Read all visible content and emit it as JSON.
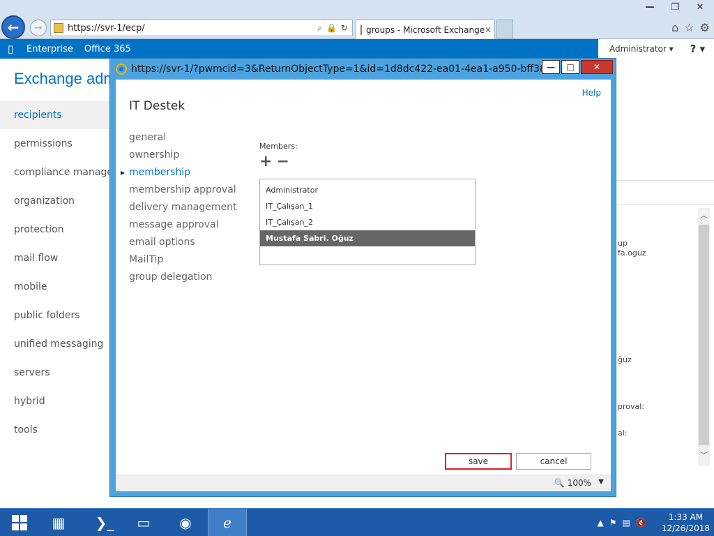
{
  "browser": {
    "address": "https://svr-1/ecp/",
    "tab_title": "groups - Microsoft Exchange",
    "tab_close": "✕",
    "window_controls": {
      "minimize": "—",
      "restore": "❐",
      "close": "✕"
    }
  },
  "topbar": {
    "logo": "▯",
    "links": [
      "Enterprise",
      "Office 365"
    ],
    "user": "Administrator ▾",
    "help": "? ▾"
  },
  "app_title": "Exchange adm",
  "left_nav": {
    "items": [
      "recipients",
      "permissions",
      "compliance managem",
      "organization",
      "protection",
      "mail flow",
      "mobile",
      "public folders",
      "unified messaging",
      "servers",
      "hybrid",
      "tools"
    ],
    "selected": "recipients"
  },
  "background_fragments": [
    "up",
    "fa.oguz",
    "ğuz",
    "proval:",
    "al:"
  ],
  "dialog": {
    "url": "https://svr-1/?pwmcid=3&ReturnObjectType=1&id=1d8dc422-ea01-4ea1-a950-bff38f6...",
    "help": "Help",
    "group_name": "IT Destek",
    "sections": [
      "general",
      "ownership",
      "membership",
      "membership approval",
      "delivery management",
      "message approval",
      "email options",
      "MailTip",
      "group delegation"
    ],
    "active_section": "membership",
    "members_label": "Members:",
    "add_symbol": "+",
    "remove_symbol": "−",
    "members": [
      "Administrator",
      "IT_Çalışan_1",
      "IT_Çalışan_2",
      "Mustafa Sabri. Oğuz"
    ],
    "selected_member": "Mustafa Sabri. Oğuz",
    "save_label": "save",
    "cancel_label": "cancel",
    "zoom": "100%"
  },
  "taskbar": {
    "time": "1:33 AM",
    "date": "12/26/2018"
  }
}
